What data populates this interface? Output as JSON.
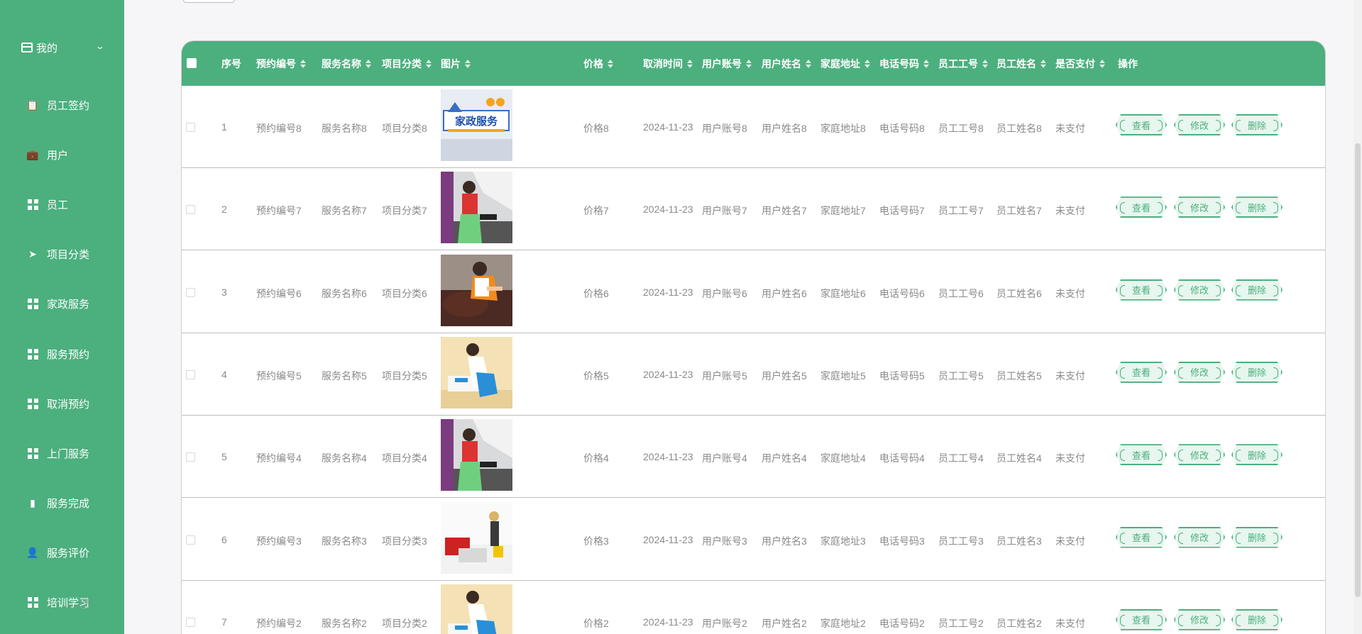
{
  "sidebar": {
    "header": "我的",
    "items": [
      {
        "label": "员工签约",
        "icon": "clipboard-icon"
      },
      {
        "label": "用户",
        "icon": "briefcase-icon"
      },
      {
        "label": "员工",
        "icon": "grid-icon"
      },
      {
        "label": "项目分类",
        "icon": "paper-plane-icon"
      },
      {
        "label": "家政服务",
        "icon": "grid-icon"
      },
      {
        "label": "服务预约",
        "icon": "grid-icon"
      },
      {
        "label": "取消预约",
        "icon": "grid-icon"
      },
      {
        "label": "上门服务",
        "icon": "grid-icon"
      },
      {
        "label": "服务完成",
        "icon": "bar-chart-icon"
      },
      {
        "label": "服务评价",
        "icon": "user-icon"
      },
      {
        "label": "培训学习",
        "icon": "grid-icon"
      }
    ]
  },
  "table": {
    "headers": [
      "序号",
      "预约编号",
      "服务名称",
      "项目分类",
      "图片",
      "价格",
      "取消时间",
      "用户账号",
      "用户姓名",
      "家庭地址",
      "电话号码",
      "员工工号",
      "员工姓名",
      "是否支付",
      "操作"
    ],
    "buttons": {
      "view": "查看",
      "edit": "修改",
      "delete": "删除"
    },
    "rows": [
      {
        "no": "1",
        "code": "预约编号8",
        "service": "服务名称8",
        "category": "项目分类8",
        "image": "banner",
        "image_text": "家政服务",
        "price": "价格8",
        "cancel_time": "2024-11-23",
        "account": "用户账号8",
        "user_name": "用户姓名8",
        "address": "家庭地址8",
        "phone": "电话号码8",
        "emp_no": "员工工号8",
        "emp_name": "员工姓名8",
        "paid": "未支付"
      },
      {
        "no": "2",
        "code": "预约编号7",
        "service": "服务名称7",
        "category": "项目分类7",
        "image": "kitchen",
        "price": "价格7",
        "cancel_time": "2024-11-23",
        "account": "用户账号7",
        "user_name": "用户姓名7",
        "address": "家庭地址7",
        "phone": "电话号码7",
        "emp_no": "员工工号7",
        "emp_name": "员工姓名7",
        "paid": "未支付"
      },
      {
        "no": "3",
        "code": "预约编号6",
        "service": "服务名称6",
        "category": "项目分类6",
        "image": "sofa",
        "price": "价格6",
        "cancel_time": "2024-11-23",
        "account": "用户账号6",
        "user_name": "用户姓名6",
        "address": "家庭地址6",
        "phone": "电话号码6",
        "emp_no": "员工工号6",
        "emp_name": "员工姓名6",
        "paid": "未支付"
      },
      {
        "no": "4",
        "code": "预约编号5",
        "service": "服务名称5",
        "category": "项目分类5",
        "image": "wiping",
        "price": "价格5",
        "cancel_time": "2024-11-23",
        "account": "用户账号5",
        "user_name": "用户姓名5",
        "address": "家庭地址5",
        "phone": "电话号码5",
        "emp_no": "员工工号5",
        "emp_name": "员工姓名5",
        "paid": "未支付"
      },
      {
        "no": "5",
        "code": "预约编号4",
        "service": "服务名称4",
        "category": "项目分类4",
        "image": "kitchen",
        "price": "价格4",
        "cancel_time": "2024-11-23",
        "account": "用户账号4",
        "user_name": "用户姓名4",
        "address": "家庭地址4",
        "phone": "电话号码4",
        "emp_no": "员工工号4",
        "emp_name": "员工姓名4",
        "paid": "未支付"
      },
      {
        "no": "6",
        "code": "预约编号3",
        "service": "服务名称3",
        "category": "项目分类3",
        "image": "living-room",
        "price": "价格3",
        "cancel_time": "2024-11-23",
        "account": "用户账号3",
        "user_name": "用户姓名3",
        "address": "家庭地址3",
        "phone": "电话号码3",
        "emp_no": "员工工号3",
        "emp_name": "员工姓名3",
        "paid": "未支付"
      },
      {
        "no": "7",
        "code": "预约编号2",
        "service": "服务名称2",
        "category": "项目分类2",
        "image": "wiping",
        "price": "价格2",
        "cancel_time": "2024-11-23",
        "account": "用户账号2",
        "user_name": "用户姓名2",
        "address": "家庭地址2",
        "phone": "电话号码2",
        "emp_no": "员工工号2",
        "emp_name": "员工姓名2",
        "paid": "未支付"
      }
    ]
  },
  "colors": {
    "accent": "#4caf7e",
    "button_bg": "#e7f6ee"
  }
}
